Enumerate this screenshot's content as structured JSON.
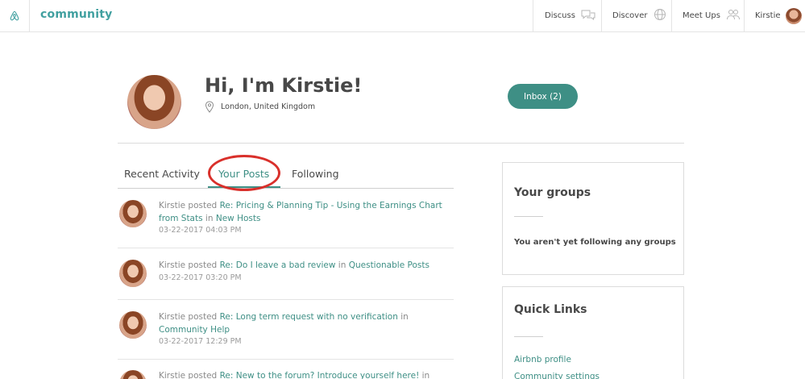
{
  "topbar": {
    "brand": "community",
    "nav": {
      "discuss": "Discuss",
      "discover": "Discover",
      "meetups": "Meet Ups",
      "user": "Kirstie"
    }
  },
  "profile": {
    "greeting": "Hi, I'm Kirstie!",
    "location": "London, United Kingdom",
    "inbox_label": "Inbox (2)"
  },
  "tabs": {
    "recent": "Recent Activity",
    "posts": "Your Posts",
    "following": "Following"
  },
  "posts": [
    {
      "author": "Kirstie posted",
      "title": "Re: Pricing & Planning Tip - Using the Earnings Chart from Stats",
      "in": "in",
      "board": "New Hosts",
      "date": "03-22-2017 04:03 PM"
    },
    {
      "author": "Kirstie posted",
      "title": "Re: Do I leave a bad review",
      "in": "in",
      "board": "Questionable Posts",
      "date": "03-22-2017 03:20 PM"
    },
    {
      "author": "Kirstie posted",
      "title": "Re: Long term request with no verification",
      "in": "in",
      "board": "Community Help",
      "date": "03-22-2017 12:29 PM"
    },
    {
      "author": "Kirstie posted",
      "title": "Re: New to the forum? Introduce yourself here!",
      "in": "in",
      "board": "",
      "date": ""
    }
  ],
  "sidebar": {
    "groups": {
      "title": "Your groups",
      "empty_text": "You aren't yet following any groups"
    },
    "quick_links": {
      "title": "Quick Links",
      "links": [
        "Airbnb profile",
        "Community settings"
      ]
    }
  },
  "colors": {
    "accent": "#3e8f85",
    "brand": "#41a0a0",
    "highlight_circle": "#d9302b"
  }
}
